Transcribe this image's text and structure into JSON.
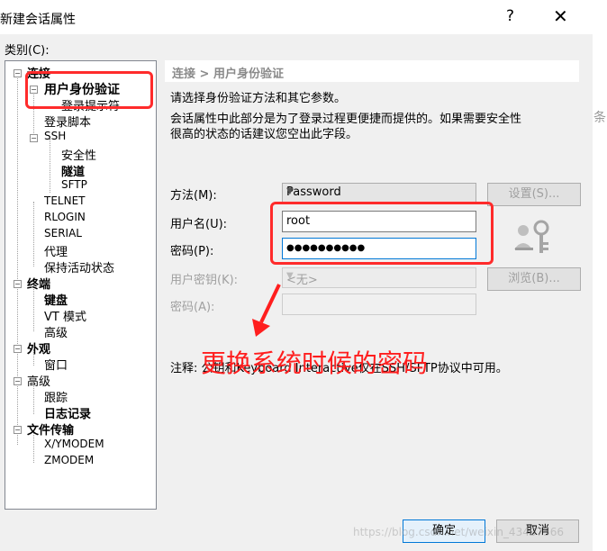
{
  "window": {
    "title": "新建会话属性",
    "help": "?",
    "close": "✕"
  },
  "category_label": "类别(C):",
  "tree": {
    "connection": "连接",
    "user_auth": "用户身份验证",
    "login_prompts": "登录提示符",
    "login_script": "登录脚本",
    "ssh": "SSH",
    "security": "安全性",
    "tunnel": "隧道",
    "sftp": "SFTP",
    "telnet": "TELNET",
    "rlogin": "RLOGIN",
    "serial": "SERIAL",
    "proxy": "代理",
    "keepalive": "保持活动状态",
    "terminal": "终端",
    "keyboard": "键盘",
    "vt_mode": "VT 模式",
    "advanced_term": "高级",
    "appearance": "外观",
    "window": "窗口",
    "advanced": "高级",
    "trace": "跟踪",
    "logging": "日志记录",
    "file_transfer": "文件传输",
    "xymodem": "X/YMODEM",
    "zmodem": "ZMODEM"
  },
  "header": "连接 > 用户身份验证",
  "desc1": "请选择身份验证方法和其它参数。",
  "desc2": "会话属性中此部分是为了登录过程更便捷而提供的。如果需要安全性",
  "desc3": "很高的状态的话建议您空出此字段。",
  "form": {
    "method_label": "方法(M):",
    "method_value": "Password",
    "settings_button": "设置(S)...",
    "username_label": "用户名(U):",
    "username_value": "root",
    "password_label": "密码(P):",
    "password_value": "●●●●●●●●●●",
    "userkey_label": "用户密钥(K):",
    "userkey_value": "<无>",
    "browse_button": "浏览(B)...",
    "passphrase_label": "密码(A):"
  },
  "note": "注释: 公钥和Keyboard Interactive仅在SSH/SFTP协议中可用。",
  "annotation": "更换系统时候的密码",
  "ok_button": "确定",
  "cancel_button": "取消",
  "watermark": "https://blog.csdn.net/weixin_43407566",
  "background_text": "条"
}
